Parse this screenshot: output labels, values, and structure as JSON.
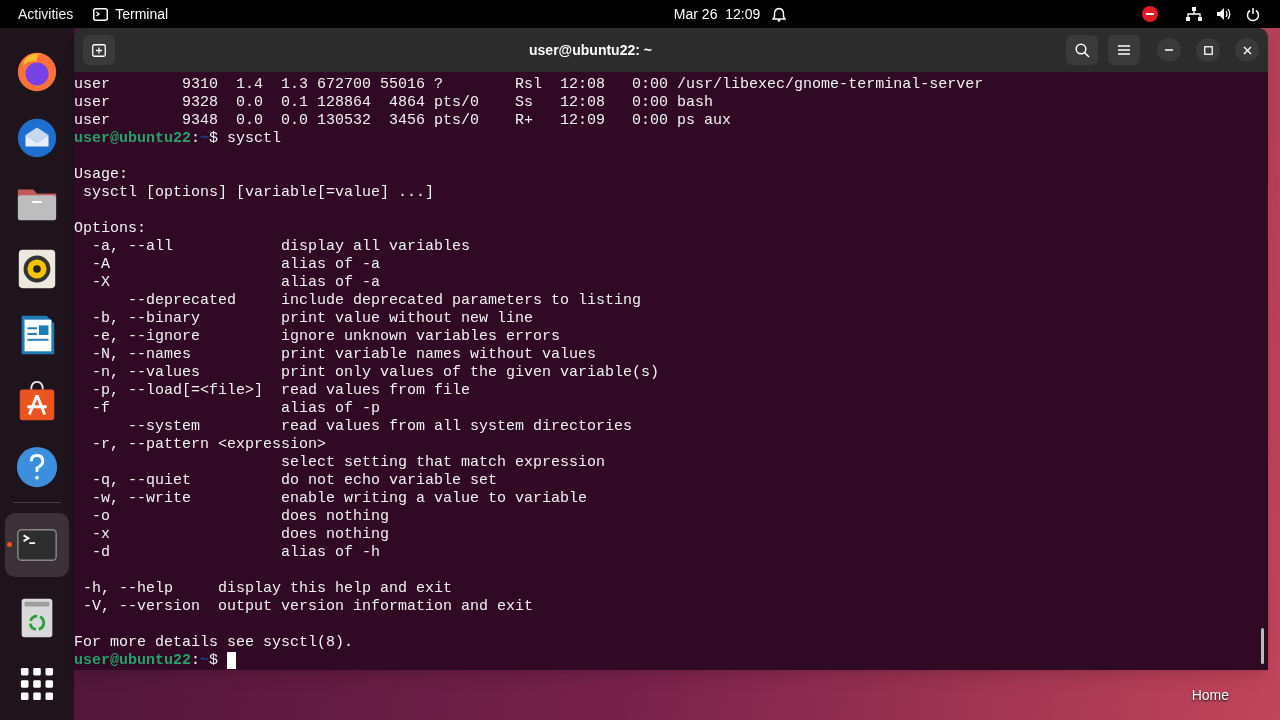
{
  "top_bar": {
    "activities": "Activities",
    "app_name": "Terminal",
    "date": "Mar 26",
    "time": "12:09"
  },
  "dock": {
    "items": [
      {
        "selected": false,
        "running": false
      },
      {
        "selected": false,
        "running": false
      },
      {
        "selected": false,
        "running": false
      },
      {
        "selected": false,
        "running": false
      },
      {
        "selected": false,
        "running": false
      },
      {
        "selected": false,
        "running": false
      },
      {
        "selected": false,
        "running": false
      },
      {
        "selected": true,
        "running": true
      },
      {
        "selected": false,
        "running": false
      },
      {
        "selected": false,
        "running": false
      }
    ]
  },
  "window": {
    "title": "user@ubuntu22: ~"
  },
  "terminal": {
    "lines": [
      {
        "kind": "output",
        "text": "user        9310  1.4  1.3 672700 55016 ?        Rsl  12:08   0:00 /usr/libexec/gnome-terminal-server"
      },
      {
        "kind": "output",
        "text": "user        9328  0.0  0.1 128864  4864 pts/0    Ss   12:08   0:00 bash"
      },
      {
        "kind": "output",
        "text": "user        9348  0.0  0.0 130532  3456 pts/0    R+   12:09   0:00 ps aux"
      },
      {
        "kind": "prompt",
        "user_host": "user@ubuntu22",
        "separator": ":",
        "path": "~",
        "symbol": "$",
        "command": "sysctl",
        "cursor": false
      },
      {
        "kind": "blank"
      },
      {
        "kind": "output",
        "text": "Usage:"
      },
      {
        "kind": "output",
        "text": " sysctl [options] [variable[=value] ...]"
      },
      {
        "kind": "blank"
      },
      {
        "kind": "output",
        "text": "Options:"
      },
      {
        "kind": "output",
        "text": "  -a, --all            display all variables"
      },
      {
        "kind": "output",
        "text": "  -A                   alias of -a"
      },
      {
        "kind": "output",
        "text": "  -X                   alias of -a"
      },
      {
        "kind": "output",
        "text": "      --deprecated     include deprecated parameters to listing"
      },
      {
        "kind": "output",
        "text": "  -b, --binary         print value without new line"
      },
      {
        "kind": "output",
        "text": "  -e, --ignore         ignore unknown variables errors"
      },
      {
        "kind": "output",
        "text": "  -N, --names          print variable names without values"
      },
      {
        "kind": "output",
        "text": "  -n, --values         print only values of the given variable(s)"
      },
      {
        "kind": "output",
        "text": "  -p, --load[=<file>]  read values from file"
      },
      {
        "kind": "output",
        "text": "  -f                   alias of -p"
      },
      {
        "kind": "output",
        "text": "      --system         read values from all system directories"
      },
      {
        "kind": "output",
        "text": "  -r, --pattern <expression>"
      },
      {
        "kind": "output",
        "text": "                       select setting that match expression"
      },
      {
        "kind": "output",
        "text": "  -q, --quiet          do not echo variable set"
      },
      {
        "kind": "output",
        "text": "  -w, --write          enable writing a value to variable"
      },
      {
        "kind": "output",
        "text": "  -o                   does nothing"
      },
      {
        "kind": "output",
        "text": "  -x                   does nothing"
      },
      {
        "kind": "output",
        "text": "  -d                   alias of -h"
      },
      {
        "kind": "blank"
      },
      {
        "kind": "output",
        "text": " -h, --help     display this help and exit"
      },
      {
        "kind": "output",
        "text": " -V, --version  output version information and exit"
      },
      {
        "kind": "blank"
      },
      {
        "kind": "output",
        "text": "For more details see sysctl(8)."
      },
      {
        "kind": "prompt",
        "user_host": "user@ubuntu22",
        "separator": ":",
        "path": "~",
        "symbol": "$",
        "cursor": true
      }
    ]
  },
  "desktop": {
    "home_label": "Home"
  }
}
